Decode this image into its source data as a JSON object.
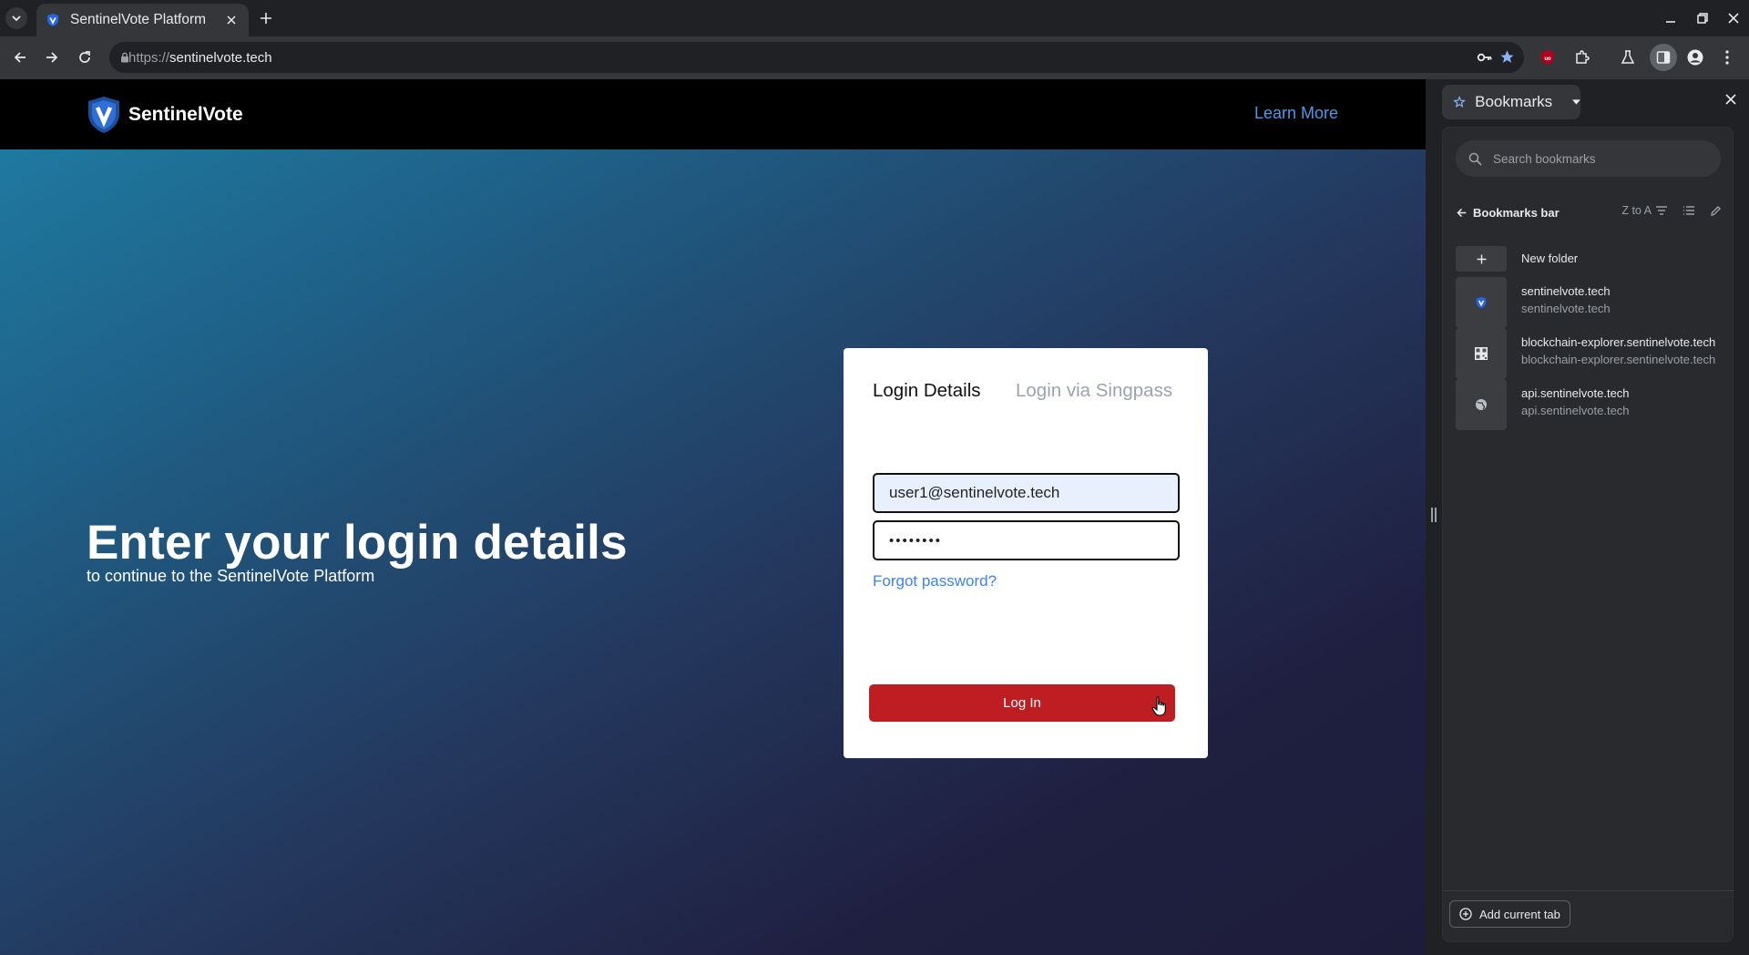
{
  "browser": {
    "tab_title": "SentinelVote Platform",
    "url_scheme": "https://",
    "url_host": "sentinelvote.tech"
  },
  "page": {
    "brand": "SentinelVote",
    "learn_more": "Learn More",
    "hero_title": "Enter your login details",
    "hero_subtitle": "to continue to the SentinelVote Platform",
    "tab_login_details": "Login Details",
    "tab_singpass": "Login via Singpass",
    "email_value": "user1@sentinelvote.tech",
    "password_value": "••••••••",
    "forgot_password": "Forgot password?",
    "login_button": "Log In",
    "colors": {
      "login_button": "#be1e22",
      "link": "#3b82f6",
      "nav_bg": "#000000"
    }
  },
  "bookmarks_panel": {
    "title": "Bookmarks",
    "search_placeholder": "Search bookmarks",
    "folder": "Bookmarks bar",
    "sort": "Z to A",
    "new_folder": "New folder",
    "items": [
      {
        "title": "sentinelvote.tech",
        "url": "sentinelvote.tech",
        "icon": "sentinelvote-favicon"
      },
      {
        "title": "blockchain-explorer.sentinelvote.tech",
        "url": "blockchain-explorer.sentinelvote.tech",
        "icon": "qr-favicon"
      },
      {
        "title": "api.sentinelvote.tech",
        "url": "api.sentinelvote.tech",
        "icon": "globe-icon"
      }
    ],
    "add_current_tab": "Add current tab"
  }
}
